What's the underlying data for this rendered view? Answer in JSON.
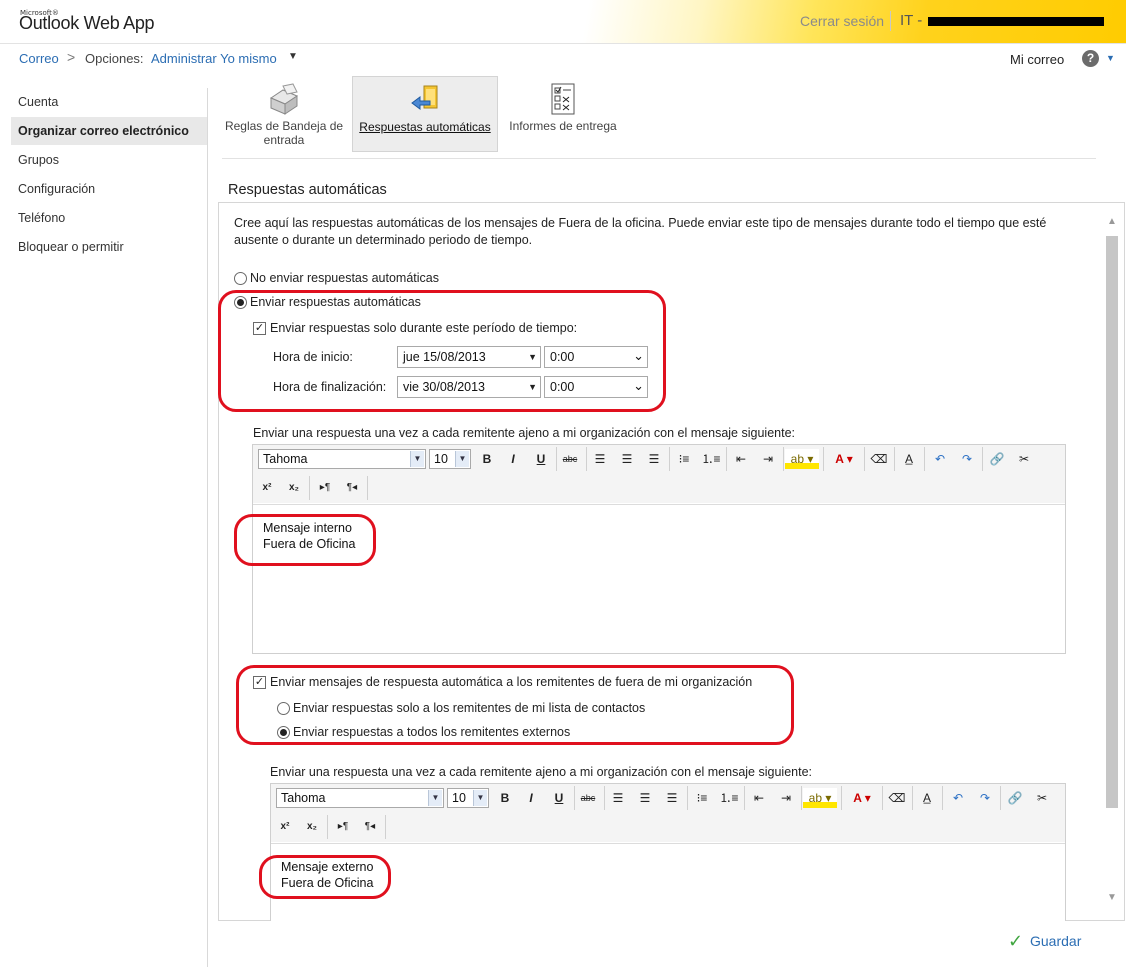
{
  "header": {
    "brand_small": "Microsoft®",
    "brand": "Outlook Web App",
    "signout": "Cerrar sesión",
    "user_prefix": "IT -"
  },
  "nav": {
    "mail": "Correo",
    "chevron": ">",
    "options": "Opciones:",
    "manage": "Administrar Yo mismo",
    "my_mail": "Mi correo",
    "help": "?"
  },
  "sidebar": {
    "items": [
      {
        "label": "Cuenta"
      },
      {
        "label": "Organizar correo electrónico"
      },
      {
        "label": "Grupos"
      },
      {
        "label": "Configuración"
      },
      {
        "label": "Teléfono"
      },
      {
        "label": "Bloquear o permitir"
      }
    ]
  },
  "tabs": [
    {
      "label": "Reglas de Bandeja de entrada",
      "icon": "inbox-rules-icon"
    },
    {
      "label": "Respuestas automáticas",
      "icon": "auto-reply-icon"
    },
    {
      "label": "Informes de entrega",
      "icon": "delivery-report-icon"
    }
  ],
  "section_title": "Respuestas automáticas",
  "intro": "Cree aquí las respuestas automáticas de los mensajes de Fuera de la oficina. Puede enviar este tipo de mensajes durante todo el tiempo que esté ausente o durante un determinado periodo de tiempo.",
  "options": {
    "no_send": "No enviar respuestas automáticas",
    "send": "Enviar respuestas automáticas",
    "period": "Enviar respuestas solo durante este período de tiempo:",
    "start_label": "Hora de inicio:",
    "start_date": "jue 15/08/2013",
    "start_time": "0:00",
    "end_label": "Hora de finalización:",
    "end_date": "vie 30/08/2013",
    "end_time": "0:00"
  },
  "internal": {
    "label": "Enviar una respuesta una vez a cada remitente ajeno a mi organización con el mensaje siguiente:",
    "font": "Tahoma",
    "size": "10",
    "line1": "Mensaje interno",
    "line2": "Fuera de Oficina"
  },
  "external": {
    "check_label": "Enviar mensajes de respuesta automática a los remitentes de fuera de mi organización",
    "contacts_only": "Enviar respuestas solo a los remitentes de mi lista de contactos",
    "all_external": "Enviar respuestas a todos los remitentes externos",
    "label": "Enviar una respuesta una vez a cada remitente ajeno a mi organización con el mensaje siguiente:",
    "font": "Tahoma",
    "size": "10",
    "line1": "Mensaje externo",
    "line2": "Fuera de Oficina"
  },
  "toolbar": {
    "bold": "B",
    "italic": "I",
    "underline": "U",
    "strike": "abc",
    "superscript": "x²",
    "subscript": "x₂"
  },
  "save_label": "Guardar",
  "colors": {
    "accent": "#2b6db3",
    "annotation": "#e0101e",
    "header_yellow": "#ffcc00"
  }
}
